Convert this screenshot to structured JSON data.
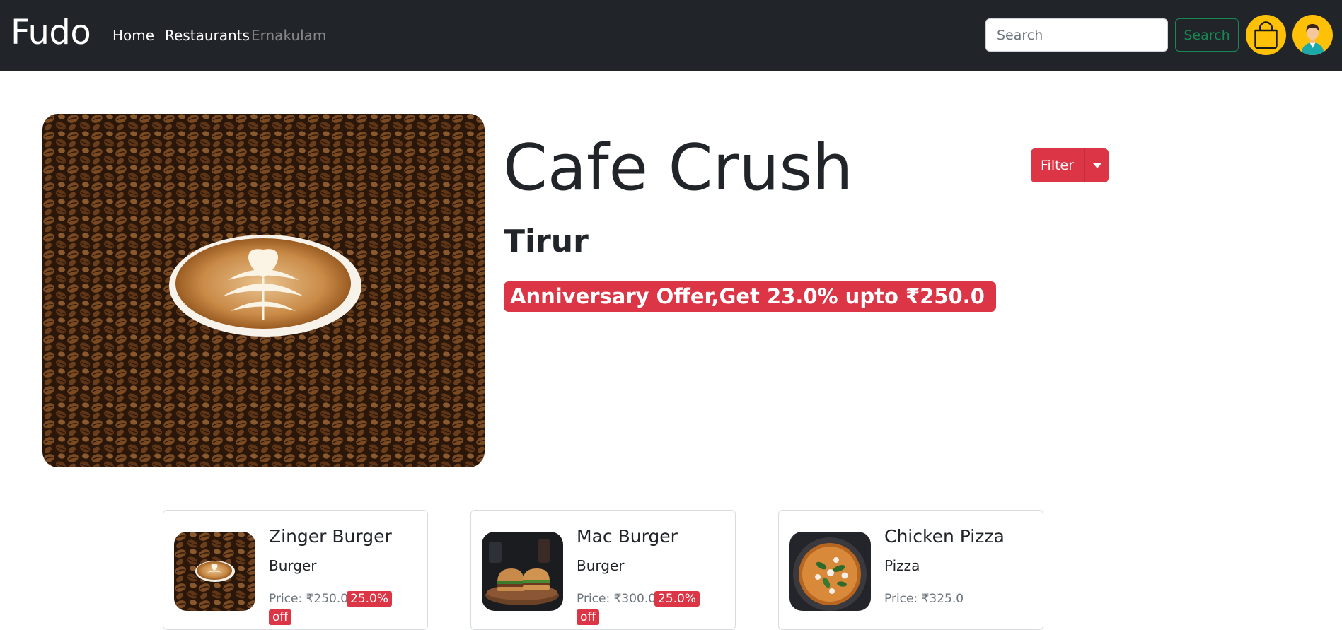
{
  "navbar": {
    "brand": "Fudo",
    "links": [
      {
        "label": "Home"
      },
      {
        "label": "Restaurants"
      },
      {
        "label": "Ernakulam"
      }
    ],
    "search": {
      "placeholder": "Search",
      "button_label": "Search"
    },
    "cart_icon": "shopping-bag-icon",
    "profile_icon": "user-avatar-icon"
  },
  "restaurant": {
    "name": "Cafe Crush",
    "location": "Tirur",
    "offer": "Anniversary Offer,Get 23.0% upto ₹250.0",
    "image": "latte-art-on-coffee-beans"
  },
  "filter": {
    "label": "Filter",
    "icon": "caret-down-icon"
  },
  "menu_items": [
    {
      "name": "Zinger Burger",
      "category": "Burger",
      "price": "Price: ₹250.0 |",
      "discount": "25.0%",
      "discount_wrap": "off",
      "image": "latte-art-on-coffee-beans"
    },
    {
      "name": "Mac Burger",
      "category": "Burger",
      "price": "Price: ₹300.0 |",
      "discount": "25.0%",
      "discount_wrap": "off",
      "image": "burgers-on-board"
    },
    {
      "name": "Chicken Pizza",
      "category": "Pizza",
      "price": "Price: ₹325.0",
      "image": "pizza-with-spinach"
    }
  ],
  "colors": {
    "navbar_bg": "#212529",
    "accent_red": "#dc3545",
    "search_green": "#198754",
    "yellow": "#ffc107"
  }
}
